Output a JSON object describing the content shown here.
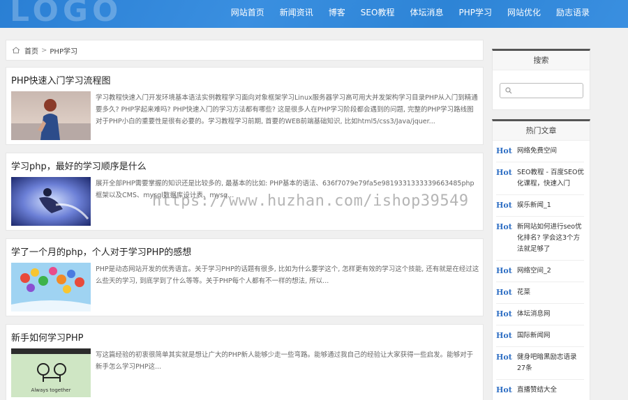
{
  "header": {
    "logo": "LOGO",
    "nav": [
      "网站首页",
      "新闻资讯",
      "博客",
      "SEO教程",
      "体坛消息",
      "PHP学习",
      "网站优化",
      "励志语录"
    ]
  },
  "breadcrumb": {
    "home": "首页",
    "separator": ">",
    "current": "PHP学习"
  },
  "articles": [
    {
      "title": "PHP快速入门学习流程图",
      "summary": "学习教程快速入门开发环境基本语法实例教程学习面向对象框架学习Linux服务器学习高可用大并发架构学习目录PHP从入门到精通要多久? PHP学起来难吗? PHP快速入门的学习方法都有哪些? 这是很多人在PHP学习阶段都会遇到的问题, 完整的PHP学习路线图对于PHP小白的重要性是很有必要的。学习教程学习前期, 首要的WEB前端基础知识, 比如html5/css3/Java/jquer..."
    },
    {
      "title": "学习php，最好的学习顺序是什么",
      "summary": "展开全部PHP需要掌握的知识还是比较多的, 最基本的比如: PHP基本的语法、636f7079e79fa5e9819331333339663485php框架以及CMS、mysql数据库设计表、mysq..."
    },
    {
      "title": "学了一个月的php，个人对于学习PHP的感想",
      "summary": "PHP是动态网站开发的优秀语言。关于学习PHP的话题有很多, 比如为什么要学这个, 怎样更有效的学习这个技能, 还有就是在经过这么些天的学习, 到底学到了什么等等。关于PHP每个人都有不一样的想法, 所以..."
    },
    {
      "title": "新手如何学习PHP",
      "summary": "写这篇经验的初衷很简单其实就是想让广大的PHP新人能够少走一些弯路。能够通过我自己的经验让大家获得一些启发。能够对于新手怎么学习PHP这..."
    }
  ],
  "thumb4_text": "Always together",
  "watermark": "https://www.huzhan.com/ishop39549",
  "sidebar": {
    "search_title": "搜索",
    "search_placeholder": "",
    "hot_title": "热门文章",
    "hot_tag": "Hot",
    "hot_items": [
      "网络免费空间",
      "SEO教程 - 百度SEO优化课程，快速入门",
      "娱乐新闻_1",
      "新网站如何进行seo优化排名? 学会这3个方法就足够了",
      "网络空间_2",
      "花菜",
      "体坛消息网",
      "国际新闻网",
      "健身吧暗黑励志语录27条",
      "直播赞结大全"
    ]
  },
  "colors": {
    "header": "#2f87d8",
    "hot": "#2f6fc4"
  }
}
